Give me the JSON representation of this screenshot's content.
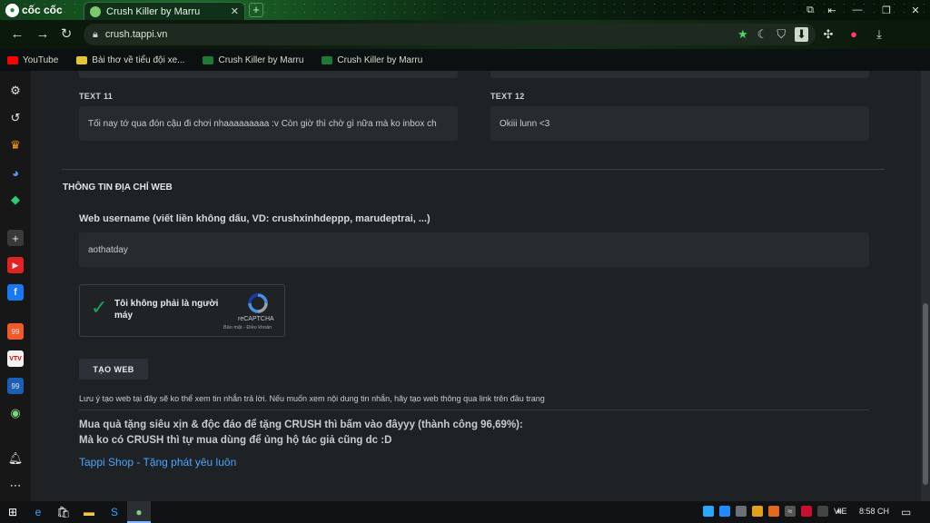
{
  "browser": {
    "brand": "cốc cốc",
    "tab_title": "Crush Killer by Marru",
    "url": "crush.tappi.vn",
    "bookmarks": [
      {
        "label": "YouTube",
        "color": "#ff0000"
      },
      {
        "label": "Bài thơ về tiểu đội xe...",
        "color": "#e3c53a"
      },
      {
        "label": "Crush Killer by Marru",
        "color": "#1d7a35"
      },
      {
        "label": "Crush Killer by Marru",
        "color": "#1d7a35"
      }
    ]
  },
  "sidebar": {
    "items": [
      "gear-icon",
      "history-icon",
      "crown-icon",
      "messenger-icon",
      "game-icon",
      "add-icon",
      "youtube-icon",
      "facebook-icon",
      "app-99-icon",
      "vtv-icon",
      "news-99-icon",
      "cube-icon",
      "bell-icon",
      "more-icon"
    ]
  },
  "form": {
    "text11_label": "TEXT 11",
    "text11_value": "Tối nay tớ qua đón cậu đi chơi nhaaaaaaaaa :v Còn giờ thì chờ gì nữa mà ko inbox ch",
    "text12_label": "TEXT 12",
    "text12_value": "Okiii lunn <3",
    "section_title": "THÔNG TIN ĐỊA CHỈ WEB",
    "username_label": "Web username (viết liền không dấu, VD: crushxinhdeppp, marudeptrai, ...)",
    "username_value": "aothatday",
    "recaptcha": {
      "text": "Tôi không phải là người máy",
      "brand": "reCAPTCHA",
      "links": "Bảo mật - Điều khoản"
    },
    "create_button": "TẠO WEB",
    "note": "Lưu ý tạo web tại đây sẽ ko thể xem tin nhắn trả lời. Nếu muốn xem nội dung tin nhắn, hãy tạo web thông qua link trên đầu trang",
    "promo_line1": "Mua quà tặng siêu xịn & độc đáo để tặng CRUSH thì bấm vào đâyyy (thành công 96,69%):",
    "promo_line2": "Mà ko có CRUSH thì tự mua dùng để ủng hộ tác giả cũng dc :D",
    "shop_link": "Tappi Shop - Tặng phát yêu luôn"
  },
  "taskbar": {
    "language": "VIE",
    "time": "8:58 CH"
  },
  "colors": {
    "accent_link": "#4ca3ff",
    "check_green": "#1fa350",
    "page_bg": "#1f2225"
  }
}
